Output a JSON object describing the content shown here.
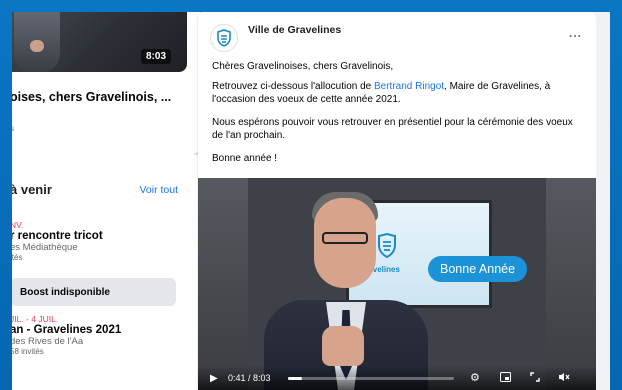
{
  "sidebar": {
    "video": {
      "duration": "8:03",
      "title": "oises, chers Gravelinois, ...",
      "meta": "s"
    },
    "events": {
      "heading": "à venir",
      "see_all": "Voir tout",
      "items": [
        {
          "date": "NV.",
          "title": "r rencontre tricot",
          "location": "es Médiathèque",
          "meta": "ités"
        },
        {
          "date": "JIL. - 4 JUIL.",
          "title": "an - Gravelines 2021",
          "location": "des Rives de l'Aa",
          "meta": "58 invités"
        }
      ],
      "boost": "Boost indisponible"
    }
  },
  "post": {
    "page_name": "Ville de Gravelines",
    "more_label": "...",
    "greeting": "Chères Gravelinoises, chers Gravelinois,",
    "p1_before": "Retrouvez ci-dessous l'allocution de ",
    "p1_link": "Bertrand Ringot",
    "p1_after": ", Maire de Gravelines, à l'occasion des voeux de cette année 2021.",
    "p2": "Nous espérons pouvoir vous retrouver en présentiel pour la cérémonie des voeux de l'an prochain.",
    "p3": "Bonne année !",
    "video": {
      "screen_brand": "Gravelines",
      "banner": "Bonne Année",
      "time": "0:41 / 8:03",
      "progress_fraction": 0.085
    }
  },
  "colors": {
    "frame": "#0a76c4",
    "link": "#1877f2",
    "banner": "#1c93d6",
    "event_date": "#e4405f"
  }
}
